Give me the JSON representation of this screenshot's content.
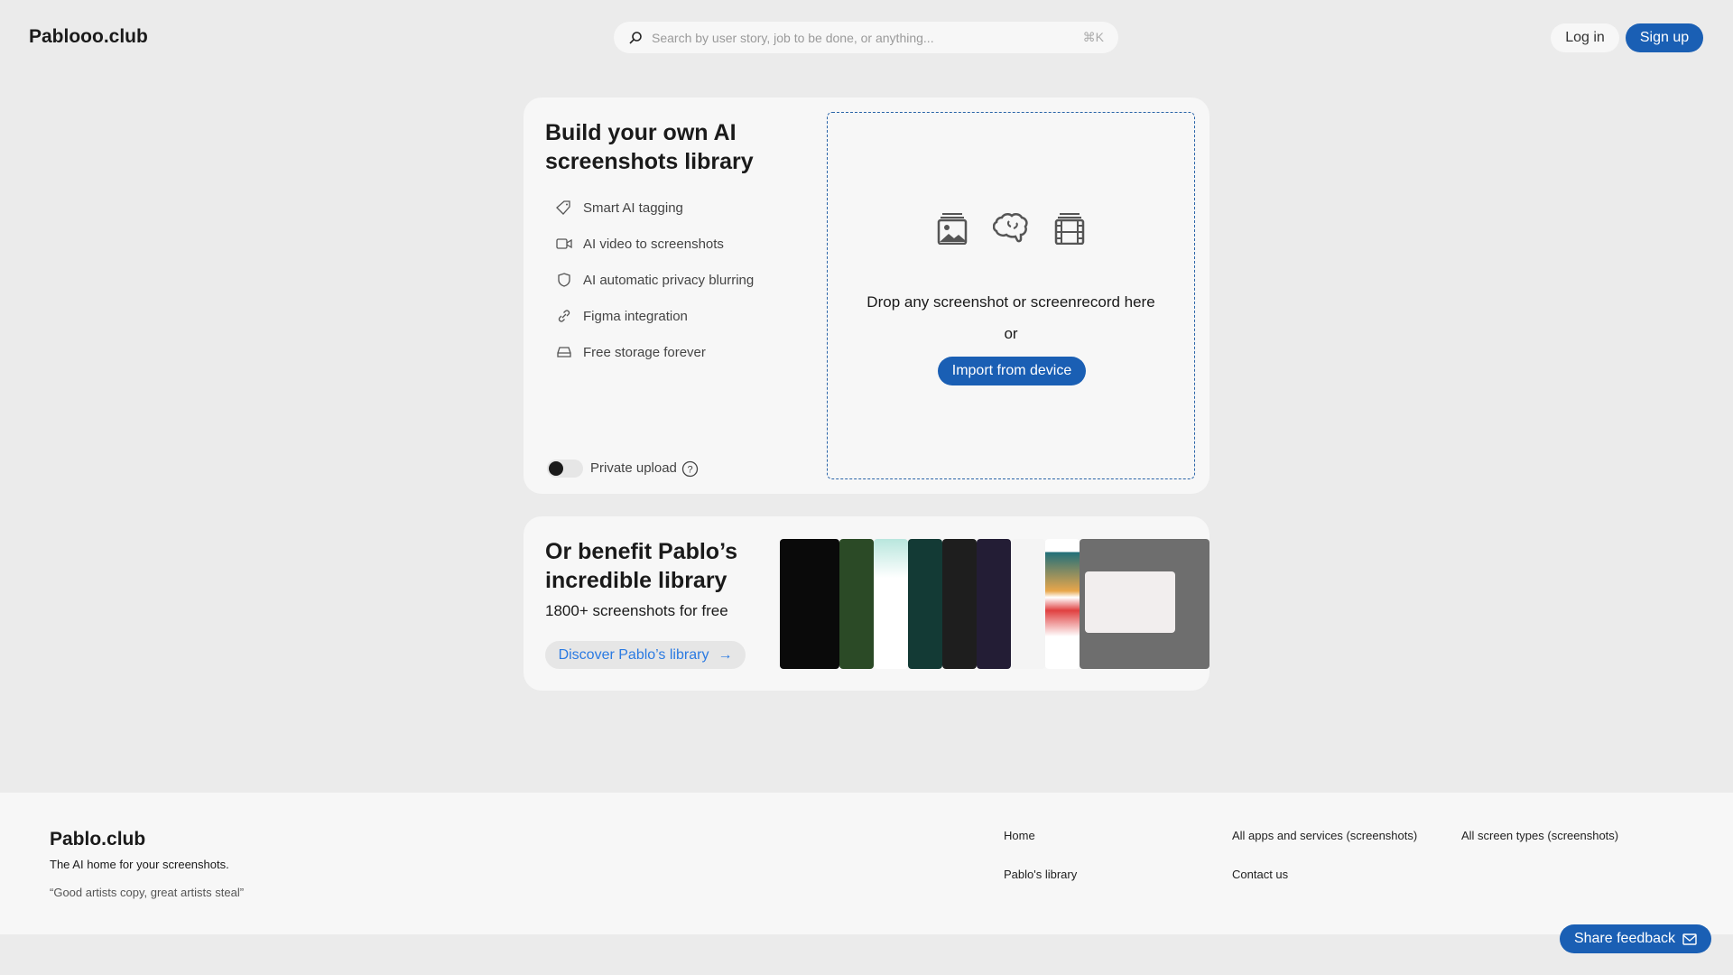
{
  "header": {
    "logo": "Pablooo.club",
    "search_placeholder": "Search by user story, job to be done, or anything...",
    "shortcut": "⌘K",
    "login": "Log in",
    "signup": "Sign up"
  },
  "build": {
    "title_line1": "Build your own AI",
    "title_line2": "screenshots library",
    "features": [
      {
        "icon": "tag-icon",
        "label": "Smart AI tagging"
      },
      {
        "icon": "video-icon",
        "label": "AI video to screenshots"
      },
      {
        "icon": "shield-icon",
        "label": "AI automatic privacy blurring"
      },
      {
        "icon": "link-icon",
        "label": "Figma integration"
      },
      {
        "icon": "drive-icon",
        "label": "Free storage forever"
      }
    ],
    "private_upload": "Private upload",
    "private_upload_on": false,
    "drop_text": "Drop any screenshot or screenrecord here",
    "or": "or",
    "import": "Import from device"
  },
  "library": {
    "title_line1": "Or benefit Pablo’s",
    "title_line2": "incredible library",
    "subtitle": "1800+ screenshots for free",
    "discover": "Discover Pablo’s library"
  },
  "footer": {
    "brand": "Pablo.club",
    "tagline": "The AI home for your screenshots.",
    "quote": "“Good artists copy, great artists steal”",
    "links": [
      "Home",
      "Pablo's library",
      "All apps and services (screenshots)",
      "Contact us",
      "All screen types (screenshots)"
    ]
  },
  "feedback": "Share feedback",
  "colors": {
    "accent": "#1a5fb4",
    "link": "#2a7ae2",
    "background": "#ebebeb",
    "card": "#f7f7f7"
  }
}
